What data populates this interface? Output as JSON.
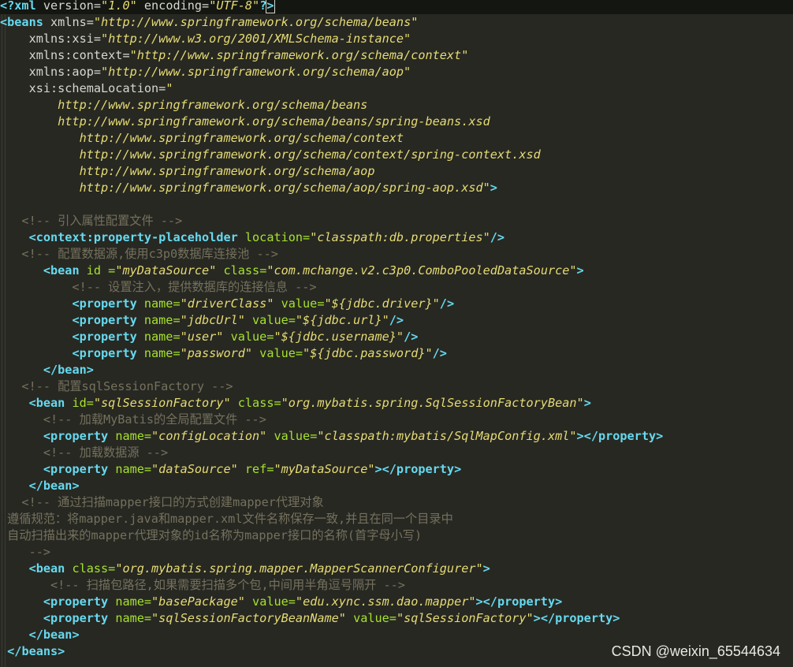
{
  "editor": {
    "theme_colors": {
      "background": "#272822",
      "tag": "#66d9ef",
      "attribute": "#a6e22e",
      "string": "#e6db74",
      "comment": "#75715e",
      "plain": "#d7d7d0"
    },
    "lines": [
      [
        [
          "tag",
          "<?xml "
        ],
        [
          "pun",
          "version="
        ],
        [
          "str",
          "\"1.0\""
        ],
        [
          "pun",
          " encoding="
        ],
        [
          "str",
          "\"UTF-8\""
        ],
        [
          "tag",
          "?"
        ],
        [
          "cur",
          ">"
        ]
      ],
      [
        [
          "tag",
          "<beans "
        ],
        [
          "pun",
          "xmlns="
        ],
        [
          "str",
          "\"http://www.springframework.org/schema/beans\""
        ]
      ],
      [
        [
          "pun",
          "    xmlns:xsi="
        ],
        [
          "str",
          "\"http://www.w3.org/2001/XMLSchema-instance\""
        ]
      ],
      [
        [
          "pun",
          "    xmlns:context="
        ],
        [
          "str",
          "\"http://www.springframework.org/schema/context\""
        ]
      ],
      [
        [
          "pun",
          "    xmlns:aop="
        ],
        [
          "str",
          "\"http://www.springframework.org/schema/aop\""
        ]
      ],
      [
        [
          "pun",
          "    xsi:schemaLocation="
        ],
        [
          "str",
          "\""
        ]
      ],
      [
        [
          "str",
          "        http://www.springframework.org/schema/beans"
        ]
      ],
      [
        [
          "str",
          "        http://www.springframework.org/schema/beans/spring-beans.xsd"
        ]
      ],
      [
        [
          "str",
          "           http://www.springframework.org/schema/context"
        ]
      ],
      [
        [
          "str",
          "           http://www.springframework.org/schema/context/spring-context.xsd"
        ]
      ],
      [
        [
          "str",
          "           http://www.springframework.org/schema/aop"
        ]
      ],
      [
        [
          "str",
          "           http://www.springframework.org/schema/aop/spring-aop.xsd\""
        ],
        [
          "tag",
          ">"
        ]
      ],
      [],
      [
        [
          "cmt",
          "   <!-- 引入属性配置文件 -->"
        ]
      ],
      [
        [
          "pun",
          "    "
        ],
        [
          "tag",
          "<context:property-placeholder "
        ],
        [
          "attr",
          "location="
        ],
        [
          "str",
          "\"classpath:db.properties\""
        ],
        [
          "tag",
          "/>"
        ]
      ],
      [
        [
          "cmt",
          "   <!-- 配置数据源,使用c3p0数据库连接池 -->"
        ]
      ],
      [
        [
          "pun",
          "      "
        ],
        [
          "tag",
          "<bean "
        ],
        [
          "attr",
          "id ="
        ],
        [
          "str",
          "\"myDataSource\""
        ],
        [
          "attr",
          " class="
        ],
        [
          "str",
          "\"com.mchange.v2.c3p0.ComboPooledDataSource\""
        ],
        [
          "tag",
          ">"
        ]
      ],
      [
        [
          "cmt",
          "          <!-- 设置注入，提供数据库的连接信息 -->"
        ]
      ],
      [
        [
          "pun",
          "          "
        ],
        [
          "tag",
          "<property "
        ],
        [
          "attr",
          "name="
        ],
        [
          "str",
          "\"driverClass\""
        ],
        [
          "attr",
          " value="
        ],
        [
          "str",
          "\"${jdbc.driver}\""
        ],
        [
          "tag",
          "/>"
        ]
      ],
      [
        [
          "pun",
          "          "
        ],
        [
          "tag",
          "<property "
        ],
        [
          "attr",
          "name="
        ],
        [
          "str",
          "\"jdbcUrl\""
        ],
        [
          "attr",
          " value="
        ],
        [
          "str",
          "\"${jdbc.url}\""
        ],
        [
          "tag",
          "/>"
        ]
      ],
      [
        [
          "pun",
          "          "
        ],
        [
          "tag",
          "<property "
        ],
        [
          "attr",
          "name="
        ],
        [
          "str",
          "\"user\""
        ],
        [
          "attr",
          " value="
        ],
        [
          "str",
          "\"${jdbc.username}\""
        ],
        [
          "tag",
          "/>"
        ]
      ],
      [
        [
          "pun",
          "          "
        ],
        [
          "tag",
          "<property "
        ],
        [
          "attr",
          "name="
        ],
        [
          "str",
          "\"password\""
        ],
        [
          "attr",
          " value="
        ],
        [
          "str",
          "\"${jdbc.password}\""
        ],
        [
          "tag",
          "/>"
        ]
      ],
      [
        [
          "pun",
          "      "
        ],
        [
          "tag",
          "</bean>"
        ]
      ],
      [
        [
          "cmt",
          "   <!-- 配置sqlSessionFactory -->"
        ]
      ],
      [
        [
          "pun",
          "    "
        ],
        [
          "tag",
          "<bean "
        ],
        [
          "attr",
          "id="
        ],
        [
          "str",
          "\"sqlSessionFactory\""
        ],
        [
          "attr",
          " class="
        ],
        [
          "str",
          "\"org.mybatis.spring.SqlSessionFactoryBean\""
        ],
        [
          "tag",
          ">"
        ]
      ],
      [
        [
          "cmt",
          "      <!-- 加载MyBatis的全局配置文件 -->"
        ]
      ],
      [
        [
          "pun",
          "      "
        ],
        [
          "tag",
          "<property "
        ],
        [
          "attr",
          "name="
        ],
        [
          "str",
          "\"configLocation\""
        ],
        [
          "attr",
          " value="
        ],
        [
          "str",
          "\"classpath:mybatis/SqlMapConfig.xml\""
        ],
        [
          "tag",
          "></property>"
        ]
      ],
      [
        [
          "cmt",
          "      <!-- 加载数据源 -->"
        ]
      ],
      [
        [
          "pun",
          "      "
        ],
        [
          "tag",
          "<property "
        ],
        [
          "attr",
          "name="
        ],
        [
          "str",
          "\"dataSource\""
        ],
        [
          "attr",
          " ref="
        ],
        [
          "str",
          "\"myDataSource\""
        ],
        [
          "tag",
          "></property>"
        ]
      ],
      [
        [
          "pun",
          "    "
        ],
        [
          "tag",
          "</bean>"
        ]
      ],
      [
        [
          "cmt",
          "   <!-- 通过扫描mapper接口的方式创建mapper代理对象"
        ]
      ],
      [
        [
          "cmt",
          " 遵循规范：将mapper.java和mapper.xml文件名称保存一致,并且在同一个目录中"
        ]
      ],
      [
        [
          "cmt",
          " 自动扫描出来的mapper代理对象的id名称为mapper接口的名称(首字母小写)"
        ]
      ],
      [
        [
          "cmt",
          "    -->"
        ]
      ],
      [
        [
          "pun",
          "    "
        ],
        [
          "tag",
          "<bean "
        ],
        [
          "attr",
          "class="
        ],
        [
          "str",
          "\"org.mybatis.spring.mapper.MapperScannerConfigurer\""
        ],
        [
          "tag",
          ">"
        ]
      ],
      [
        [
          "cmt",
          "       <!-- 扫描包路径,如果需要扫描多个包,中间用半角逗号隔开 -->"
        ]
      ],
      [
        [
          "pun",
          "      "
        ],
        [
          "tag",
          "<property "
        ],
        [
          "attr",
          "name="
        ],
        [
          "str",
          "\"basePackage\""
        ],
        [
          "attr",
          " value="
        ],
        [
          "str",
          "\"edu.xync.ssm.dao.mapper\""
        ],
        [
          "tag",
          "></property>"
        ]
      ],
      [
        [
          "pun",
          "      "
        ],
        [
          "tag",
          "<property "
        ],
        [
          "attr",
          "name="
        ],
        [
          "str",
          "\"sqlSessionFactoryBeanName\""
        ],
        [
          "attr",
          " value="
        ],
        [
          "str",
          "\"sqlSessionFactory\""
        ],
        [
          "tag",
          "></property>"
        ]
      ],
      [
        [
          "pun",
          "    "
        ],
        [
          "tag",
          "</bean>"
        ]
      ],
      [
        [
          "pun",
          " "
        ],
        [
          "tag",
          "</beans>"
        ]
      ]
    ]
  },
  "watermark": "CSDN @weixin_65544634"
}
